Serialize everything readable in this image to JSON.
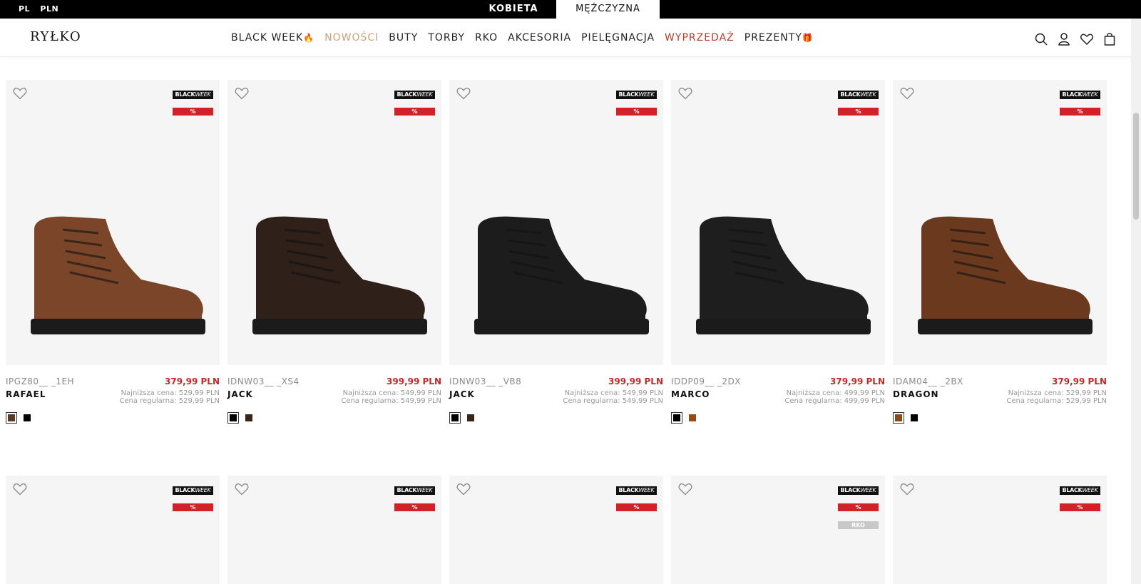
{
  "topbar": {
    "lang": "PL",
    "currency": "PLN",
    "tab_women": "KOBIETA",
    "tab_men": "MĘŻCZYZNA"
  },
  "header": {
    "logo": "RYŁKO",
    "nav": [
      {
        "label": "BLACK WEEK",
        "emoji": "🔥"
      },
      {
        "label": "NOWOŚCI"
      },
      {
        "label": "BUTY"
      },
      {
        "label": "TORBY"
      },
      {
        "label": "RKO"
      },
      {
        "label": "AKCESORIA"
      },
      {
        "label": "PIELĘGNACJA"
      },
      {
        "label": "WYPRZEDAŻ"
      },
      {
        "label": "PREZENTY",
        "emoji": "🎁"
      }
    ],
    "icons": [
      "search-icon",
      "account-icon",
      "wishlist-icon",
      "cart-icon"
    ]
  },
  "badges": {
    "black": "BLACK",
    "week": "WEEK",
    "percent": "%",
    "rko": "RKO"
  },
  "products": [
    {
      "sku": "IPGZ80__ _1EH",
      "name": "RAFAEL",
      "price": "379,99 PLN",
      "lowest": "Najniższa cena: 529,99 PLN",
      "regular": "Cena regularna: 529,99 PLN",
      "swatches": [
        "#5b3a29",
        "#000000"
      ],
      "boot_color": "#7a4528"
    },
    {
      "sku": "IDNW03__ _XS4",
      "name": "JACK",
      "price": "399,99 PLN",
      "lowest": "Najniższa cena: 549,99 PLN",
      "regular": "Cena regularna: 549,99 PLN",
      "swatches": [
        "#000000",
        "#3a2418"
      ],
      "boot_color": "#2f2019"
    },
    {
      "sku": "IDNW03__ _VB8",
      "name": "JACK",
      "price": "399,99 PLN",
      "lowest": "Najniższa cena: 549,99 PLN",
      "regular": "Cena regularna: 549,99 PLN",
      "swatches": [
        "#000000",
        "#3a2418"
      ],
      "boot_color": "#1c1c1c"
    },
    {
      "sku": "IDDP09__ _2DX",
      "name": "MARCO",
      "price": "379,99 PLN",
      "lowest": "Najniższa cena: 499,99 PLN",
      "regular": "Cena regularna: 499,99 PLN",
      "swatches": [
        "#000000",
        "#9b4a12"
      ],
      "boot_color": "#1e1e1e"
    },
    {
      "sku": "IDAM04__ _2BX",
      "name": "DRAGON",
      "price": "379,99 PLN",
      "lowest": "Najniższa cena: 529,99 PLN",
      "regular": "Cena regularna: 529,99 PLN",
      "swatches": [
        "#8a4a1a",
        "#000000"
      ],
      "boot_color": "#6b3a1e"
    }
  ],
  "row2": [
    {
      "rko": false
    },
    {
      "rko": false
    },
    {
      "rko": false
    },
    {
      "rko": true
    },
    {
      "rko": false
    }
  ]
}
